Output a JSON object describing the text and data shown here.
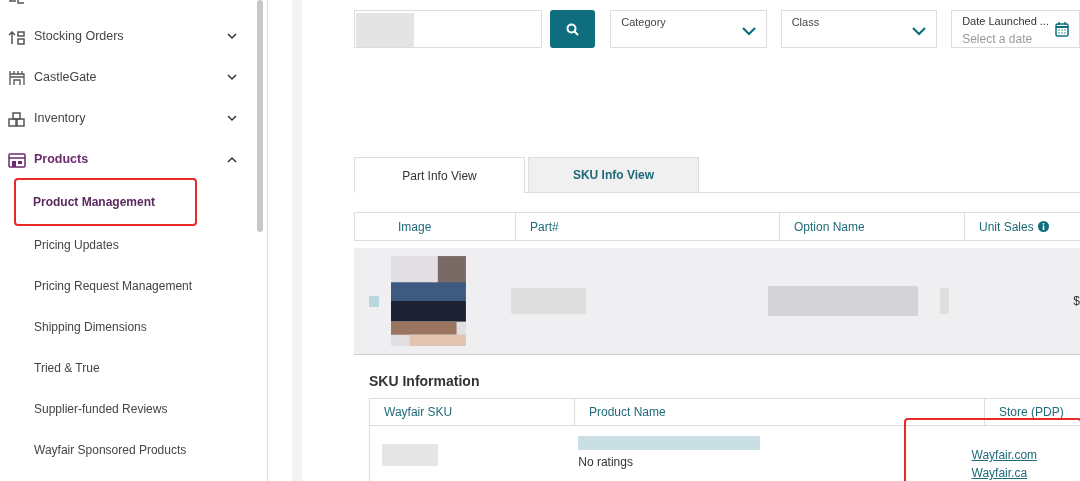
{
  "sidebar": {
    "items": [
      {
        "label": "Stocking Orders",
        "expanded": false,
        "selected": false
      },
      {
        "label": "CastleGate",
        "expanded": false,
        "selected": false
      },
      {
        "label": "Inventory",
        "expanded": false,
        "selected": false
      },
      {
        "label": "Products",
        "expanded": true,
        "selected": true,
        "children": [
          {
            "label": "Product Management",
            "selected": true,
            "highlighted": true
          },
          {
            "label": "Pricing Updates",
            "selected": false,
            "highlighted": false
          },
          {
            "label": "Pricing Request Management",
            "selected": false,
            "highlighted": false
          },
          {
            "label": "Shipping Dimensions",
            "selected": false,
            "highlighted": false
          },
          {
            "label": "Tried & True",
            "selected": false,
            "highlighted": false
          },
          {
            "label": "Supplier-funded Reviews",
            "selected": false,
            "highlighted": false
          },
          {
            "label": "Wayfair Sponsored Products",
            "selected": false,
            "highlighted": false
          }
        ]
      }
    ]
  },
  "filters": {
    "category": {
      "label": "Category"
    },
    "class": {
      "label": "Class"
    },
    "date": {
      "label": "Date Launched ...",
      "placeholder": "Select a date"
    }
  },
  "tabs": [
    {
      "label": "Part Info View",
      "selected": true
    },
    {
      "label": "SKU Info View",
      "selected": false
    }
  ],
  "table": {
    "columns": [
      "Image",
      "Part#",
      "Option Name",
      "Unit Sales"
    ],
    "rows": [
      {
        "checked": false,
        "column_5": "$"
      }
    ]
  },
  "sku_info": {
    "title": "SKU Information",
    "columns": [
      "Wayfair SKU",
      "Product Name",
      "Store (PDP)"
    ],
    "rows": [
      {
        "rating": "No ratings",
        "links": [
          "Wayfair.com",
          "Wayfair.ca"
        ],
        "highlighted": true
      }
    ]
  }
}
